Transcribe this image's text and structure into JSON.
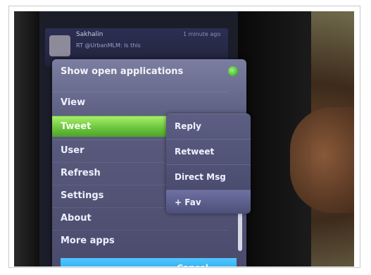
{
  "notification": {
    "name": "Sakhalin",
    "message": "RT @UrbanMLM: Is this",
    "time": "1 minute ago"
  },
  "menu": {
    "title": "Show open applications",
    "items": [
      {
        "label": "View",
        "selected": false
      },
      {
        "label": "Tweet",
        "selected": true
      },
      {
        "label": "User",
        "selected": false
      },
      {
        "label": "Refresh",
        "selected": false
      },
      {
        "label": "Settings",
        "selected": false
      },
      {
        "label": "About",
        "selected": false
      },
      {
        "label": "More apps",
        "selected": false
      }
    ]
  },
  "submenu": {
    "items": [
      {
        "label": "Reply",
        "selected": false
      },
      {
        "label": "Retweet",
        "selected": false
      },
      {
        "label": "Direct Msg",
        "selected": false
      },
      {
        "label": "+ Fav",
        "selected": true
      }
    ]
  },
  "bottom_bar": {
    "label": "Cancel"
  },
  "colors": {
    "selected_green": "#69c23c",
    "menu_bg": "#4a4b6c",
    "submenu_bg": "#44466a",
    "bottom_blue": "#1f9fe0"
  },
  "icons": {
    "avatar": "avatar",
    "toggle": "toggle-on-icon"
  }
}
